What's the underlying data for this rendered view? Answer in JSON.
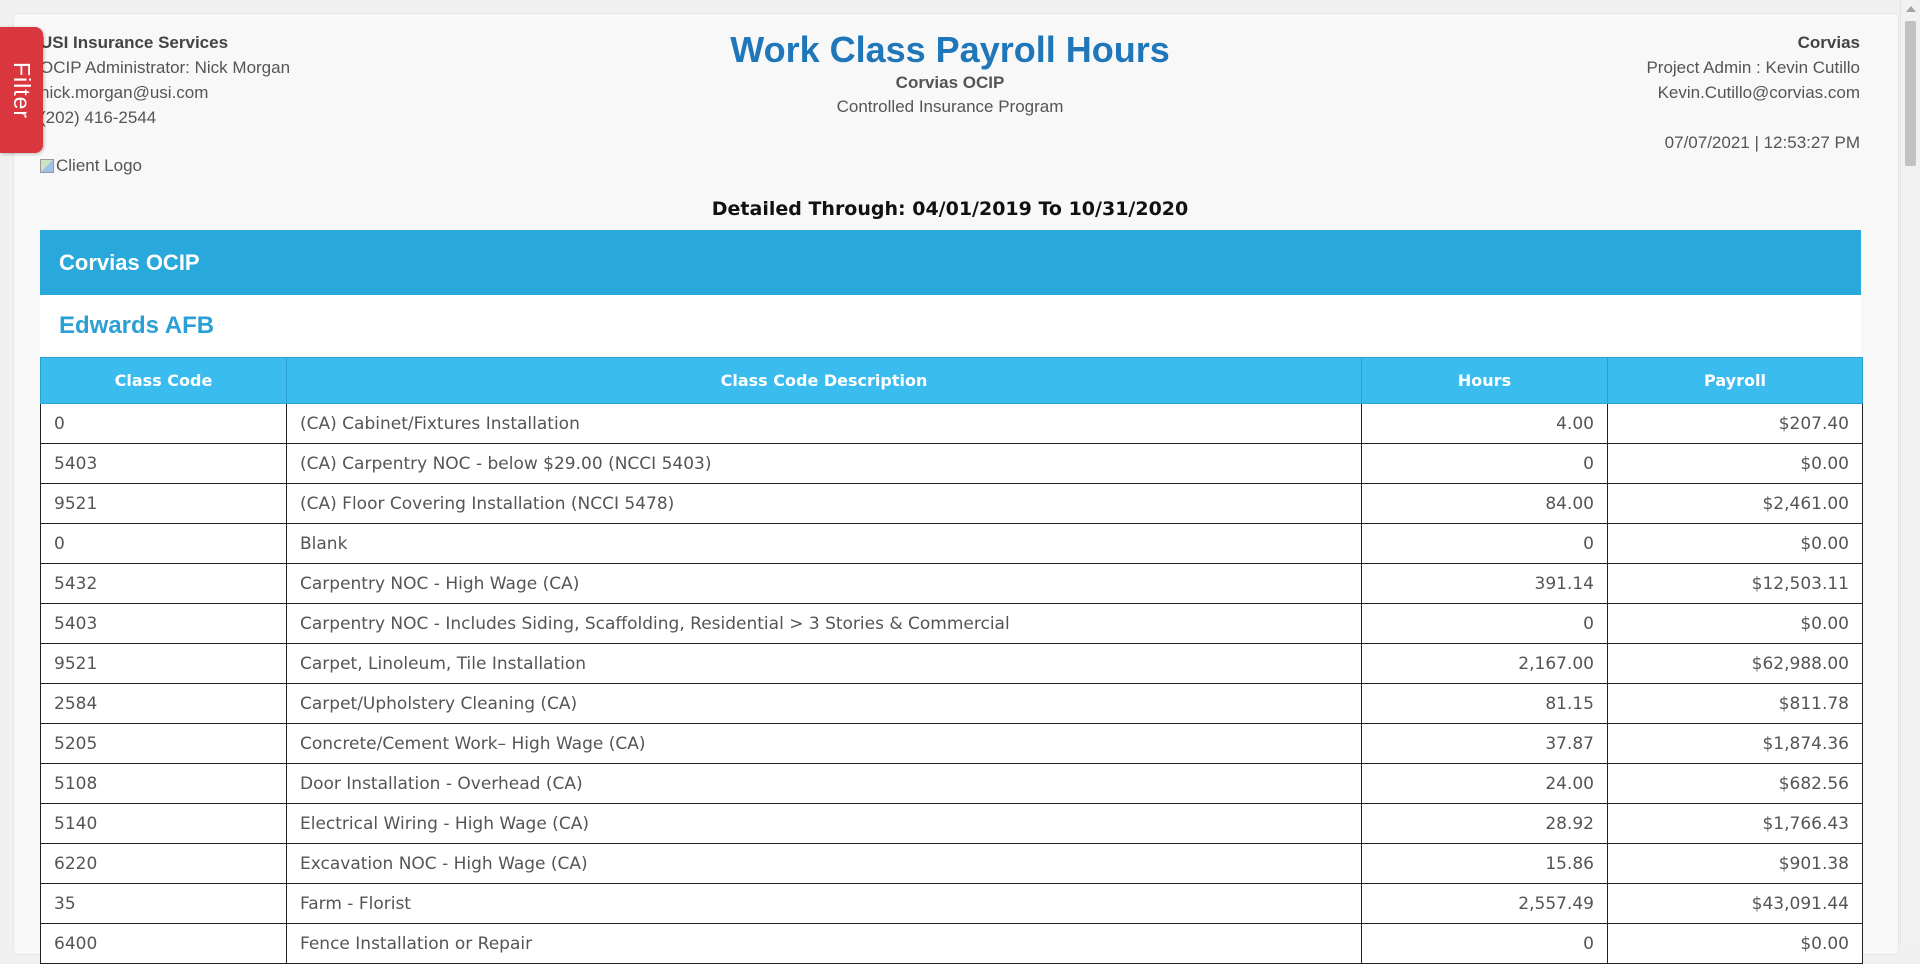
{
  "filter": {
    "label": "Filter"
  },
  "left": {
    "company": "USI Insurance Services",
    "admin": "OCIP Administrator: Nick Morgan",
    "email": "nick.morgan@usi.com",
    "phone": "(202) 416-2544",
    "logo_alt": "Client Logo"
  },
  "header": {
    "title": "Work Class Payroll Hours",
    "subtitle": "Corvias OCIP",
    "program": "Controlled Insurance Program"
  },
  "right": {
    "company": "Corvias",
    "admin": "Project Admin : Kevin Cutillo",
    "email": "Kevin.Cutillo@corvias.com",
    "timestamp": "07/07/2021 | 12:53:27 PM"
  },
  "detailed": "Detailed Through: 04/01/2019 To 10/31/2020",
  "band": "Corvias OCIP",
  "project": "Edwards AFB",
  "table": {
    "headers": [
      "Class Code",
      "Class Code Description",
      "Hours",
      "Payroll"
    ],
    "rows": [
      [
        "0",
        "(CA) Cabinet/Fixtures Installation",
        "4.00",
        "$207.40"
      ],
      [
        "5403",
        "(CA) Carpentry NOC - below $29.00 (NCCI 5403)",
        "0",
        "$0.00"
      ],
      [
        "9521",
        "(CA) Floor Covering Installation (NCCI 5478)",
        "84.00",
        "$2,461.00"
      ],
      [
        "0",
        "Blank",
        "0",
        "$0.00"
      ],
      [
        "5432",
        "Carpentry NOC - High Wage (CA)",
        "391.14",
        "$12,503.11"
      ],
      [
        "5403",
        "Carpentry NOC - Includes Siding, Scaffolding, Residential > 3 Stories & Commercial",
        "0",
        "$0.00"
      ],
      [
        "9521",
        "Carpet, Linoleum, Tile Installation",
        "2,167.00",
        "$62,988.00"
      ],
      [
        "2584",
        "Carpet/Upholstery Cleaning (CA)",
        "81.15",
        "$811.78"
      ],
      [
        "5205",
        "Concrete/Cement Work– High Wage (CA)",
        "37.87",
        "$1,874.36"
      ],
      [
        "5108",
        "Door Installation - Overhead (CA)",
        "24.00",
        "$682.56"
      ],
      [
        "5140",
        "Electrical Wiring - High Wage (CA)",
        "28.92",
        "$1,766.43"
      ],
      [
        "6220",
        "Excavation NOC - High Wage (CA)",
        "15.86",
        "$901.38"
      ],
      [
        "35",
        "Farm - Florist",
        "2,557.49",
        "$43,091.44"
      ],
      [
        "6400",
        "Fence Installation or Repair",
        "0",
        "$0.00"
      ]
    ]
  }
}
